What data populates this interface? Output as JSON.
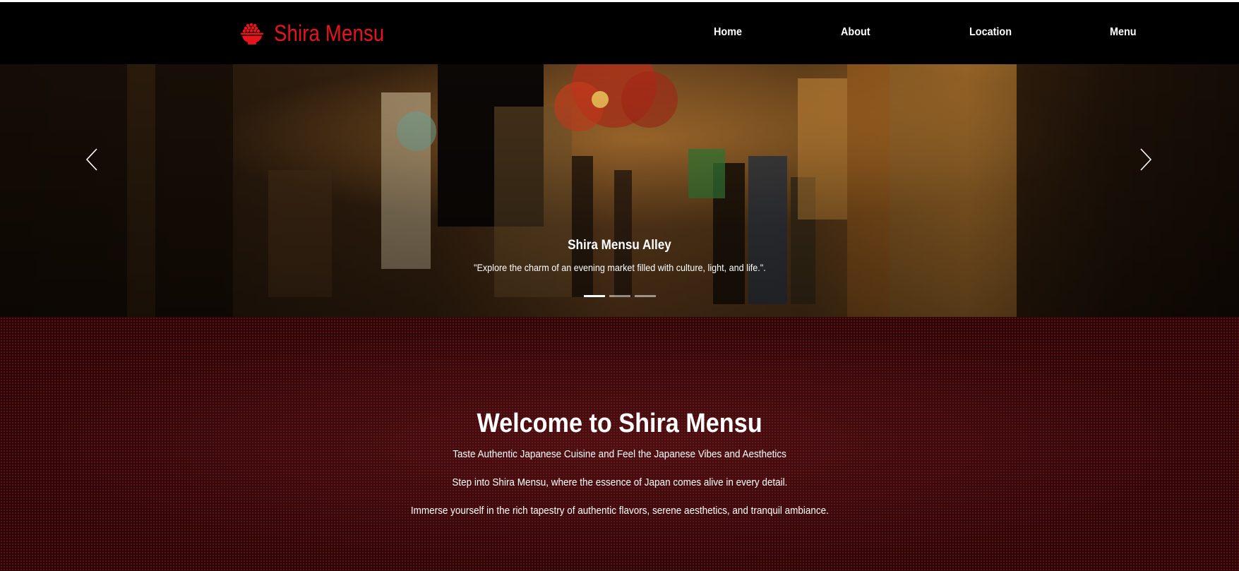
{
  "brand": {
    "name": "Shira Mensu",
    "icon": "rice-bowl-icon",
    "color": "#e8141b"
  },
  "nav": {
    "items": [
      {
        "label": "Home"
      },
      {
        "label": "About"
      },
      {
        "label": "Location"
      },
      {
        "label": "Menu"
      }
    ]
  },
  "carousel": {
    "prev_icon": "chevron-left-icon",
    "next_icon": "chevron-right-icon",
    "slide": {
      "title": "Shira Mensu Alley",
      "text": "\"Explore the charm of an evening market filled with culture, light, and life.\"."
    },
    "indicator_count": 3,
    "active_indicator": 1
  },
  "welcome": {
    "title": "Welcome to Shira Mensu",
    "lines": [
      "Taste Authentic Japanese Cuisine and Feel the Japanese Vibes and Aesthetics",
      "Step into Shira Mensu, where the essence of Japan comes alive in every detail.",
      "Immerse yourself in the rich tapestry of authentic flavors, serene aesthetics, and tranquil ambiance."
    ],
    "background_color": "#3a0a0c"
  }
}
